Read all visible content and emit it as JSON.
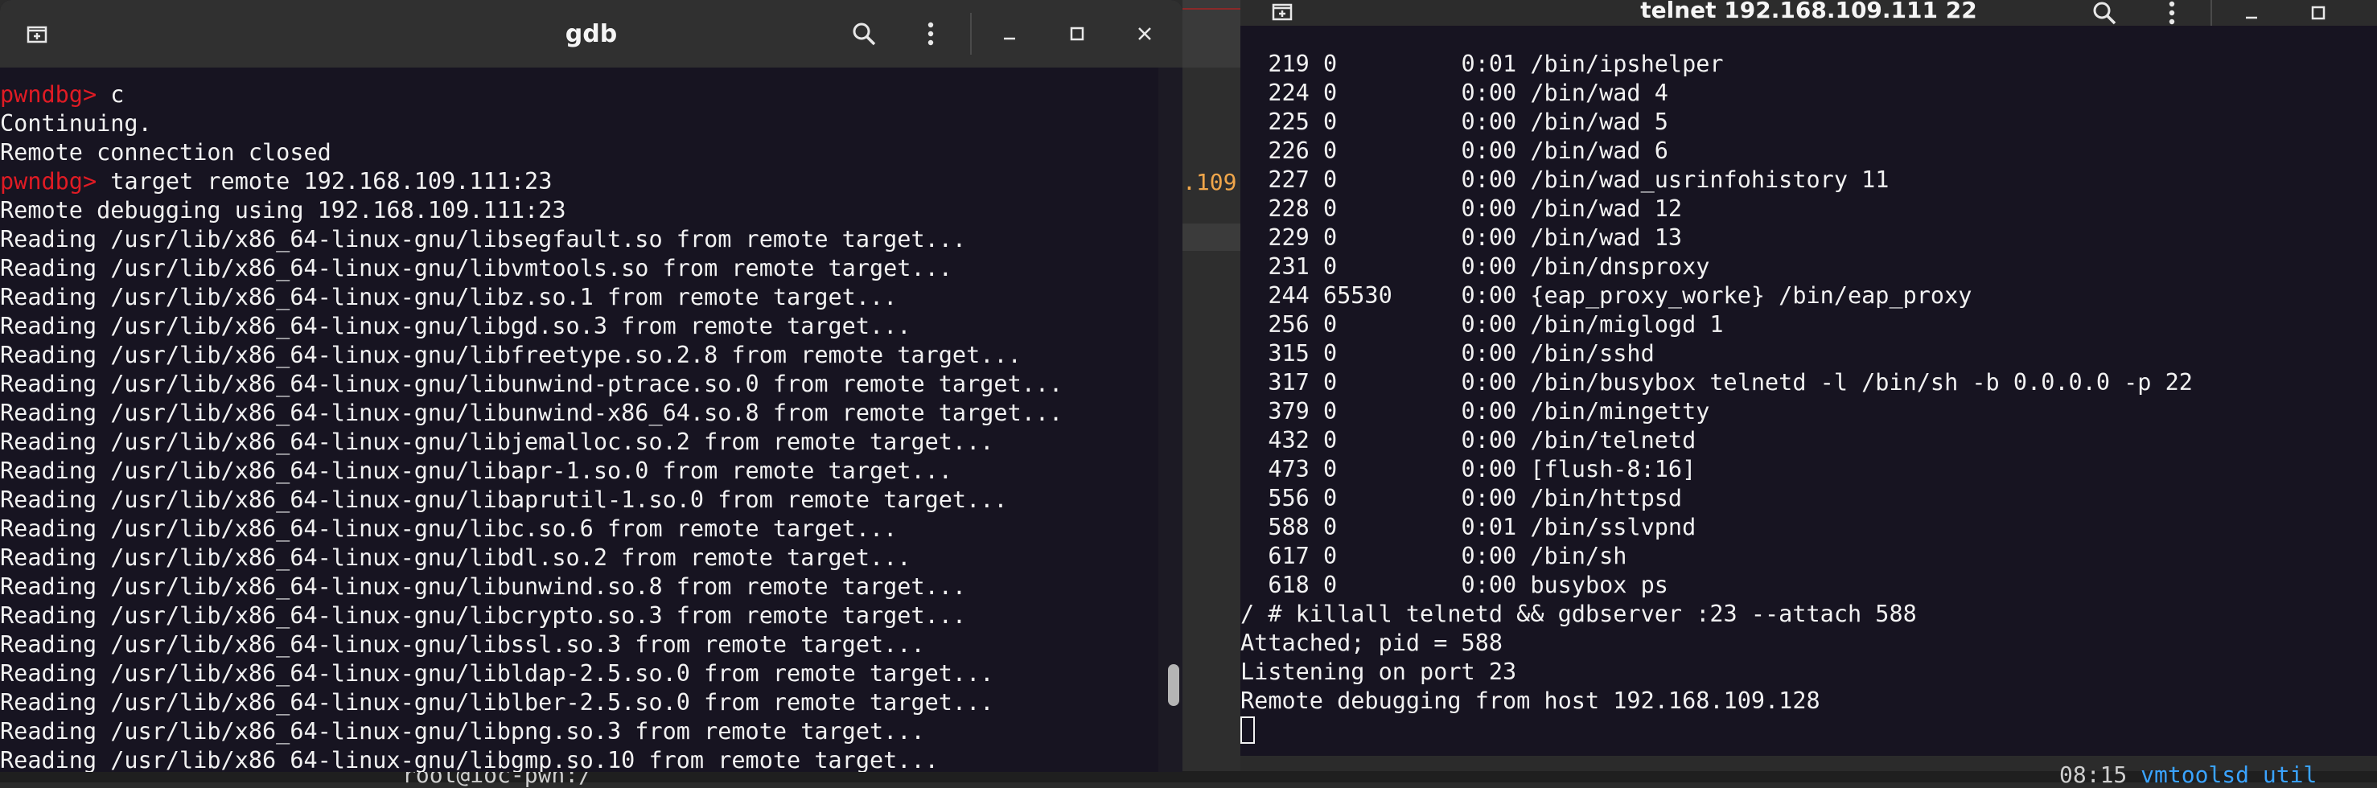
{
  "left_window": {
    "title": "gdb",
    "icons": {
      "new_tab": "new-tab-icon",
      "search": "search-icon",
      "menu": "kebab-menu-icon",
      "minimize": "minimize-icon",
      "maximize": "maximize-icon",
      "close": "close-icon"
    },
    "lines": [
      {
        "prompt": "pwndbg> ",
        "text": "c"
      },
      {
        "prompt": "",
        "text": "Continuing."
      },
      {
        "prompt": "",
        "text": "Remote connection closed"
      },
      {
        "prompt": "pwndbg> ",
        "text": "target remote 192.168.109.111:23"
      },
      {
        "prompt": "",
        "text": "Remote debugging using 192.168.109.111:23"
      },
      {
        "prompt": "",
        "text": "Reading /usr/lib/x86_64-linux-gnu/libsegfault.so from remote target..."
      },
      {
        "prompt": "",
        "text": "Reading /usr/lib/x86_64-linux-gnu/libvmtools.so from remote target..."
      },
      {
        "prompt": "",
        "text": "Reading /usr/lib/x86_64-linux-gnu/libz.so.1 from remote target..."
      },
      {
        "prompt": "",
        "text": "Reading /usr/lib/x86_64-linux-gnu/libgd.so.3 from remote target..."
      },
      {
        "prompt": "",
        "text": "Reading /usr/lib/x86_64-linux-gnu/libfreetype.so.2.8 from remote target..."
      },
      {
        "prompt": "",
        "text": "Reading /usr/lib/x86_64-linux-gnu/libunwind-ptrace.so.0 from remote target..."
      },
      {
        "prompt": "",
        "text": "Reading /usr/lib/x86_64-linux-gnu/libunwind-x86_64.so.8 from remote target..."
      },
      {
        "prompt": "",
        "text": "Reading /usr/lib/x86_64-linux-gnu/libjemalloc.so.2 from remote target..."
      },
      {
        "prompt": "",
        "text": "Reading /usr/lib/x86_64-linux-gnu/libapr-1.so.0 from remote target..."
      },
      {
        "prompt": "",
        "text": "Reading /usr/lib/x86_64-linux-gnu/libaprutil-1.so.0 from remote target..."
      },
      {
        "prompt": "",
        "text": "Reading /usr/lib/x86_64-linux-gnu/libc.so.6 from remote target..."
      },
      {
        "prompt": "",
        "text": "Reading /usr/lib/x86_64-linux-gnu/libdl.so.2 from remote target..."
      },
      {
        "prompt": "",
        "text": "Reading /usr/lib/x86_64-linux-gnu/libunwind.so.8 from remote target..."
      },
      {
        "prompt": "",
        "text": "Reading /usr/lib/x86_64-linux-gnu/libcrypto.so.3 from remote target..."
      },
      {
        "prompt": "",
        "text": "Reading /usr/lib/x86_64-linux-gnu/libssl.so.3 from remote target..."
      },
      {
        "prompt": "",
        "text": "Reading /usr/lib/x86_64-linux-gnu/libldap-2.5.so.0 from remote target..."
      },
      {
        "prompt": "",
        "text": "Reading /usr/lib/x86_64-linux-gnu/liblber-2.5.so.0 from remote target..."
      },
      {
        "prompt": "",
        "text": "Reading /usr/lib/x86_64-linux-gnu/libpng.so.3 from remote target..."
      },
      {
        "prompt": "",
        "text": "Reading /usr/lib/x86_64-linux-gnu/libgmp.so.10 from remote target..."
      }
    ]
  },
  "right_window": {
    "title": "telnet 192.168.109.111 22",
    "icons": {
      "new_tab": "new-tab-icon",
      "search": "search-icon",
      "menu": "kebab-menu-icon",
      "minimize": "minimize-icon",
      "maximize": "maximize-icon"
    },
    "lines": [
      "  219 0         0:01 /bin/ipshelper",
      "  224 0         0:00 /bin/wad 4",
      "  225 0         0:00 /bin/wad 5",
      "  226 0         0:00 /bin/wad 6",
      "  227 0         0:00 /bin/wad_usrinfohistory 11",
      "  228 0         0:00 /bin/wad 12",
      "  229 0         0:00 /bin/wad 13",
      "  231 0         0:00 /bin/dnsproxy",
      "  244 65530     0:00 {eap_proxy_worke} /bin/eap_proxy",
      "  256 0         0:00 /bin/miglogd 1",
      "  315 0         0:00 /bin/sshd",
      "  317 0         0:00 /bin/busybox telnetd -l /bin/sh -b 0.0.0.0 -p 22",
      "  379 0         0:00 /bin/mingetty",
      "  432 0         0:00 /bin/telnetd",
      "  473 0         0:00 [flush-8:16]",
      "  556 0         0:00 /bin/httpsd",
      "  588 0         0:01 /bin/sslvpnd",
      "  617 0         0:00 /bin/sh",
      "  618 0         0:00 busybox ps",
      "/ # killall telnetd && gdbserver :23 --attach 588",
      "Attached; pid = 588",
      "Listening on port 23",
      "Remote debugging from host 192.168.109.128"
    ]
  },
  "background": {
    "partial_ip": ".109",
    "bottom_left_text": "root@ioc-pwn:/",
    "bottom_right_prefix": "08:15 ",
    "bottom_right_highlight": "vmtoolsd util"
  }
}
